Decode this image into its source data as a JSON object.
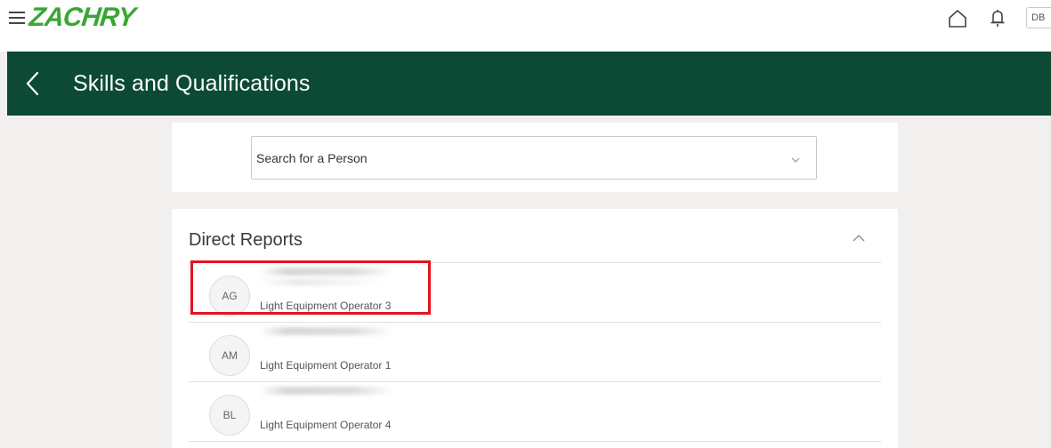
{
  "app": {
    "logo_text": "ZACHRY",
    "user_initials": "DB",
    "brand_color": "#3aa635",
    "header_color": "#0c4a36"
  },
  "header": {
    "title": "Skills and Qualifications"
  },
  "search": {
    "placeholder": "Search for a Person"
  },
  "direct_reports": {
    "title": "Direct Reports",
    "items": [
      {
        "initials": "AG",
        "job": "Light Equipment Operator 3"
      },
      {
        "initials": "AM",
        "job": "Light Equipment Operator 1"
      },
      {
        "initials": "BL",
        "job": "Light Equipment Operator 4"
      }
    ]
  },
  "icons": {
    "menu": "hamburger-menu-icon",
    "home": "home-icon",
    "notifications": "bell-icon",
    "back": "chevron-left-icon",
    "dropdown": "chevron-down-icon",
    "collapse": "chevron-up-icon"
  }
}
